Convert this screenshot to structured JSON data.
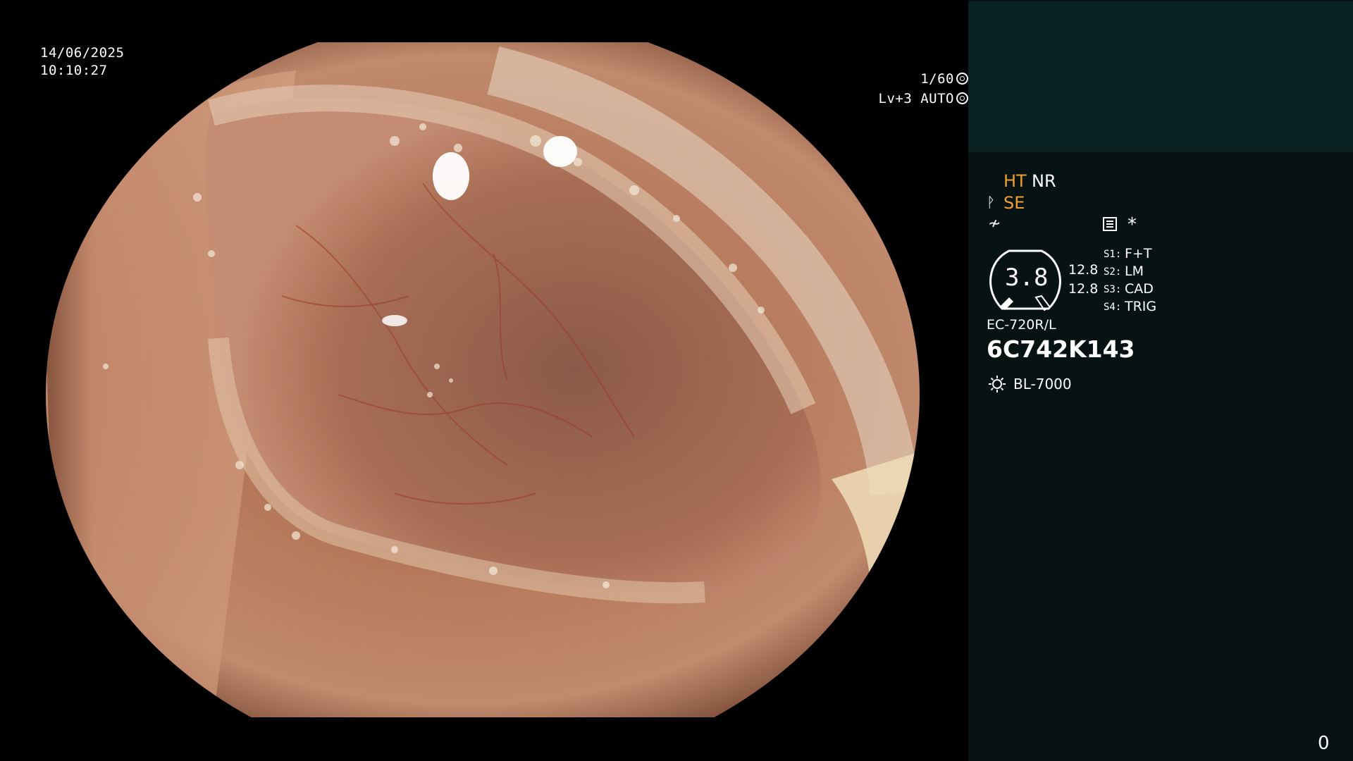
{
  "overlay": {
    "date": "14/06/2025",
    "time": "10:10:27",
    "shutter": "1/60",
    "level": "Lv+3 AUTO"
  },
  "panel": {
    "ht": "HT",
    "nr": "NR",
    "se": "SE",
    "asterisk": "*",
    "gauge_value": "3.8",
    "gauge_left": "12.8",
    "gauge_right": "12.8",
    "switches": [
      {
        "key": "S1:",
        "value": "F+T"
      },
      {
        "key": "S2:",
        "value": "LM"
      },
      {
        "key": "S3:",
        "value": "CAD"
      },
      {
        "key": "S4:",
        "value": "TRIG"
      }
    ],
    "scope_model": "EC-720R/L",
    "serial": "6C742K143",
    "light_source": "BL-7000",
    "counter": "0"
  },
  "icons": [
    "aperture-icon",
    "iris-icon",
    "scissor-icon",
    "freeze-icon",
    "menu-icon",
    "light-bulb-icon"
  ],
  "colors": {
    "background": "#000000",
    "panel": "#071313",
    "panel_top": "#0a2222",
    "accent": "#f0a030",
    "text": "#ffffff"
  }
}
